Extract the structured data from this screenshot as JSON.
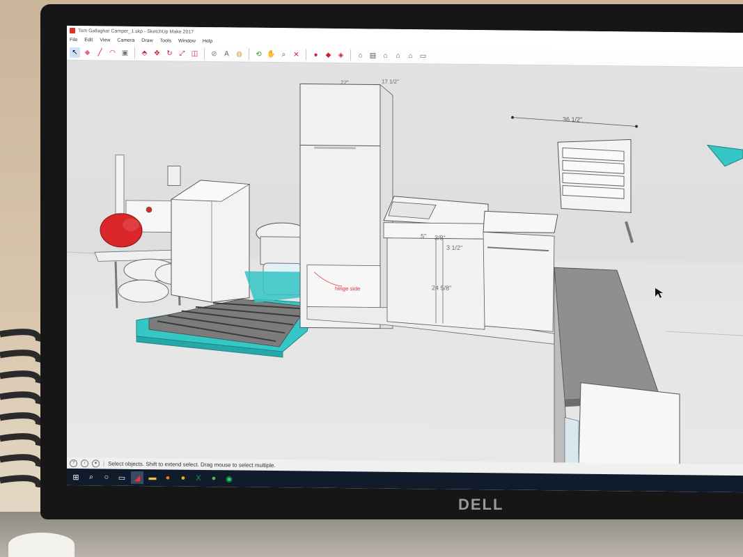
{
  "window": {
    "title": "Tom Gallaghar Camper_1.skp - SketchUp Make 2017"
  },
  "menu": [
    "File",
    "Edit",
    "View",
    "Camera",
    "Draw",
    "Tools",
    "Window",
    "Help"
  ],
  "toolbar_icons": [
    "select-icon",
    "eraser-icon",
    "pencil-icon",
    "arc-icon",
    "shape-icon",
    "push-pull-icon",
    "move-icon",
    "rotate-icon",
    "scale-icon",
    "offset-icon",
    "tape-measure-icon",
    "text-icon",
    "paint-bucket-icon",
    "orbit-icon",
    "pan-icon",
    "zoom-icon",
    "zoom-extents-icon",
    "warehouse-icon",
    "extension-icon",
    "ruby-icon",
    "iso-view-icon",
    "top-view-icon",
    "front-view-icon",
    "right-view-icon",
    "back-view-icon",
    "left-view-icon"
  ],
  "dimensions": {
    "fridge_width": "22\"",
    "fridge_depth": "17 1/2\"",
    "window_width": "36 1/2\"",
    "sink_a": "5\"",
    "sink_b": "3/8\"",
    "sink_c": "3 1/2\"",
    "sink_height": "24 5/8\""
  },
  "annotations": {
    "hinge": "hinge side"
  },
  "status": {
    "hint": "Select objects. Shift to extend select. Drag mouse to select multiple."
  },
  "monitor": {
    "brand": "DELL"
  },
  "colors": {
    "accent_teal": "#35c6c6",
    "tank_red": "#d8262a",
    "taskbar": "#101b2c"
  }
}
